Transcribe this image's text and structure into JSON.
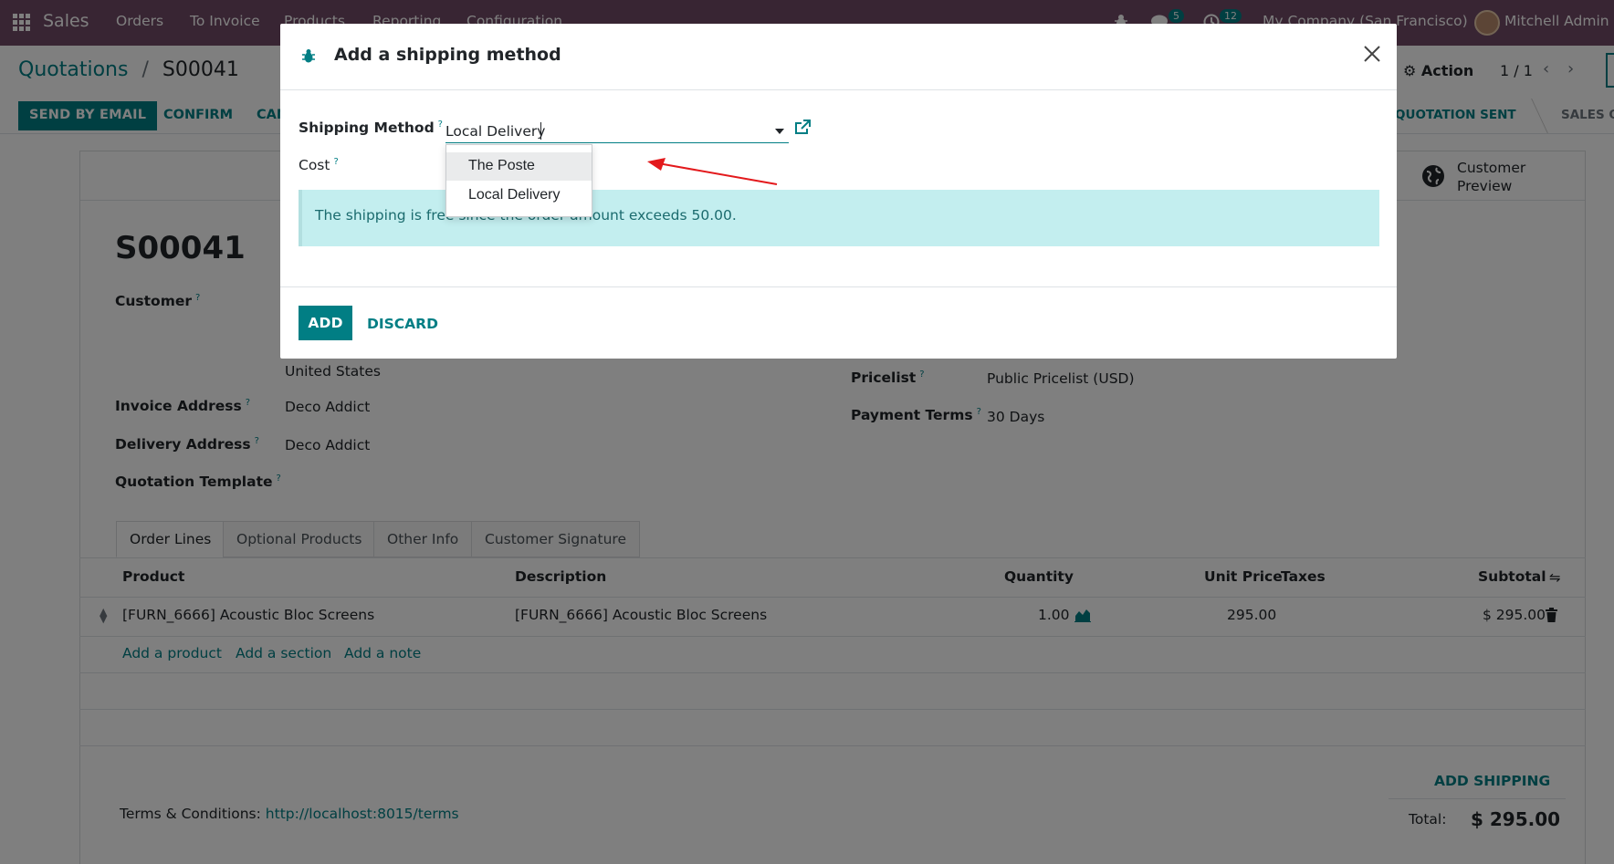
{
  "navbar": {
    "app_name": "Sales",
    "menu": [
      "Orders",
      "To Invoice",
      "Products",
      "Reporting",
      "Configuration"
    ],
    "messages_count": "5",
    "activities_count": "12",
    "company": "My Company (San Francisco)",
    "user": "Mitchell Admin (s"
  },
  "breadcrumb": {
    "parent": "Quotations",
    "separator": "/",
    "current": "S00041"
  },
  "control_panel": {
    "action_label": "Action",
    "pager": "1 / 1"
  },
  "statusbar": {
    "buttons": [
      "SEND BY EMAIL",
      "CONFIRM",
      "CAN"
    ],
    "stages": [
      "QUOTATION SENT",
      "SALES OI"
    ]
  },
  "smart_button": {
    "line1": "Customer",
    "line2": "Preview"
  },
  "order": {
    "name": "S00041",
    "labels": {
      "customer": "Customer",
      "invoice_address": "Invoice Address",
      "delivery_address": "Delivery Address",
      "quotation_template": "Quotation Template",
      "pricelist": "Pricelist",
      "payment_terms": "Payment Terms"
    },
    "country": "United States",
    "invoice_address": "Deco Addict",
    "delivery_address": "Deco Addict",
    "pricelist": "Public Pricelist (USD)",
    "payment_terms": "30 Days",
    "help_mark": "?"
  },
  "tabs": [
    "Order Lines",
    "Optional Products",
    "Other Info",
    "Customer Signature"
  ],
  "table": {
    "headers": {
      "product": "Product",
      "description": "Description",
      "quantity": "Quantity",
      "unit_price": "Unit Price",
      "taxes": "Taxes",
      "subtotal": "Subtotal"
    },
    "rows": [
      {
        "product": "[FURN_6666] Acoustic Bloc Screens",
        "description": "[FURN_6666] Acoustic Bloc Screens",
        "quantity": "1.00",
        "unit_price": "295.00",
        "taxes": "",
        "subtotal": "$ 295.00"
      }
    ],
    "add_links": [
      "Add a product",
      "Add a section",
      "Add a note"
    ]
  },
  "footer": {
    "terms_label": "Terms & Conditions:",
    "terms_url": "http://localhost:8015/terms",
    "add_shipping": "ADD SHIPPING",
    "total_label": "Total:",
    "total_value": "$ 295.00"
  },
  "dialog": {
    "title": "Add a shipping method",
    "shipping_method_label": "Shipping Method",
    "shipping_method_value": "Local Delivery",
    "cost_label": "Cost",
    "help_mark": "?",
    "dropdown_options": [
      "The Poste",
      "Local Delivery"
    ],
    "alert_text": "The shipping is free since the order amount exceeds 50.00.",
    "add_label": "ADD",
    "discard_label": "DISCARD"
  },
  "colors": {
    "brand": "#714b67",
    "accent": "#017e84",
    "alert_bg": "#c3eeef",
    "arrow": "#e3191c"
  }
}
